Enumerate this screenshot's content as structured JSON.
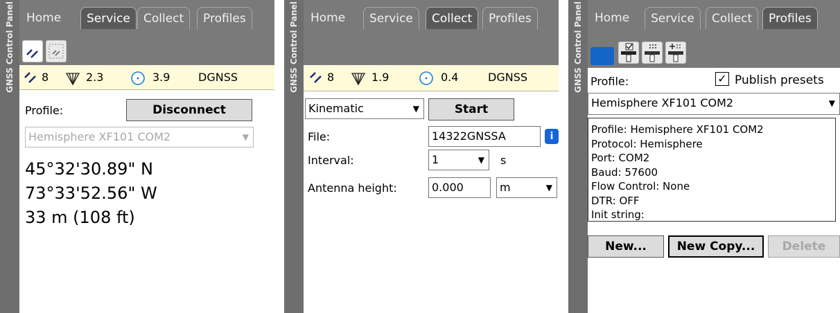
{
  "side_title": "GNSS Control Panel",
  "tabs": {
    "home": "Home",
    "service": "Service",
    "collect": "Collect",
    "profiles": "Profiles"
  },
  "status": {
    "service": {
      "satellites": "8",
      "pdop": "2.3",
      "accuracy": "3.9",
      "mode": "DGNSS"
    },
    "collect": {
      "satellites": "8",
      "pdop": "1.9",
      "accuracy": "0.4",
      "mode": "DGNSS"
    }
  },
  "service": {
    "profile_label": "Profile:",
    "disconnect_label": "Disconnect",
    "profile_value": "Hemisphere XF101 COM2",
    "latitude": "45°32'30.89\" N",
    "longitude": "73°33'52.56\" W",
    "altitude": "33 m (108 ft)"
  },
  "collect": {
    "mode_value": "Kinematic",
    "start_label": "Start",
    "file_label": "File:",
    "file_value": "14322GNSSA",
    "interval_label": "Interval:",
    "interval_value": "1",
    "interval_unit": "s",
    "antenna_label": "Antenna height:",
    "antenna_value": "0.000",
    "antenna_unit": "m"
  },
  "profiles": {
    "profile_label": "Profile:",
    "publish_label": "Publish presets",
    "publish_checked": true,
    "profile_value": "Hemisphere XF101 COM2",
    "info_lines": [
      "Profile: Hemisphere XF101 COM2",
      "Protocol: Hemisphere",
      "Port: COM2",
      "Baud: 57600",
      "Flow Control: None",
      "DTR: OFF",
      "Init string:"
    ],
    "new_label": "New...",
    "new_copy_label": "New Copy...",
    "delete_label": "Delete"
  },
  "colors": {
    "status_bg": "#fffbd9",
    "tab_bg": "#7a7a7a",
    "side_bar": "#6e6e6e",
    "info_blue": "#1565d8"
  }
}
